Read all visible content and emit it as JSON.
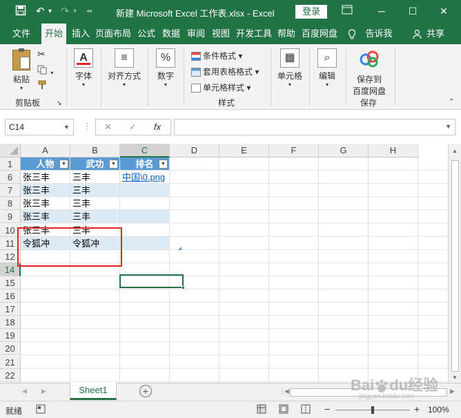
{
  "titlebar": {
    "save_icon": "save-icon",
    "undo_icon": "undo-icon",
    "redo_icon": "redo-icon",
    "title": "新建 Microsoft Excel 工作表.xlsx  -  Excel",
    "login": "登录",
    "minimize": "─",
    "restore": "☐",
    "close": "✕"
  },
  "tabs": [
    {
      "label": "文件"
    },
    {
      "label": "开始"
    },
    {
      "label": "插入"
    },
    {
      "label": "页面布局"
    },
    {
      "label": "公式"
    },
    {
      "label": "数据"
    },
    {
      "label": "审阅"
    },
    {
      "label": "视图"
    },
    {
      "label": "开发工具"
    },
    {
      "label": "帮助"
    },
    {
      "label": "百度网盘"
    },
    {
      "label": "告诉我"
    },
    {
      "label": "共享"
    }
  ],
  "ribbon": {
    "paste": "粘贴",
    "clipboard": "剪贴板",
    "font": "字体",
    "alignment": "对齐方式",
    "number": "数字",
    "conditional": "条件格式 ▾",
    "table_format": "套用表格格式 ▾",
    "cell_style": "单元格样式 ▾",
    "styles": "样式",
    "cells": "单元格",
    "editing": "编辑",
    "save_to": "保存到",
    "baidu": "百度网盘",
    "save": "保存"
  },
  "formula": {
    "namebox": "C14",
    "cancel": "✕",
    "confirm": "✓",
    "fx": "fx",
    "value": ""
  },
  "columns": [
    "A",
    "B",
    "C",
    "D",
    "E",
    "F",
    "G",
    "H"
  ],
  "rows": [
    "1",
    "6",
    "7",
    "8",
    "9",
    "10",
    "11",
    "12",
    "14",
    "15",
    "16",
    "17",
    "18",
    "19",
    "20",
    "21",
    "22"
  ],
  "table": {
    "headers": [
      "人物",
      "武功",
      "排名"
    ],
    "data": [
      [
        "张三丰",
        "三丰",
        "中国\\0.png"
      ],
      [
        "张三丰",
        "三丰",
        ""
      ],
      [
        "张三丰",
        "三丰",
        ""
      ],
      [
        "张三丰",
        "三丰",
        ""
      ],
      [
        "张三丰",
        "三丰",
        ""
      ],
      [
        "令狐冲",
        "令狐冲",
        ""
      ]
    ]
  },
  "sheets": [
    {
      "name": "Sheet1"
    }
  ],
  "status": {
    "ready": "就绪",
    "zoom": "100%",
    "minus": "−",
    "plus": "+"
  },
  "watermark": {
    "main": "Bai",
    "logo": "du",
    "suffix": "经验",
    "url": "jingyan.baidu.com"
  },
  "colors": {
    "excel_green": "#217346",
    "table_header": "#5b9bd5",
    "table_band": "#ddebf7",
    "annotation_red": "#e02424"
  }
}
